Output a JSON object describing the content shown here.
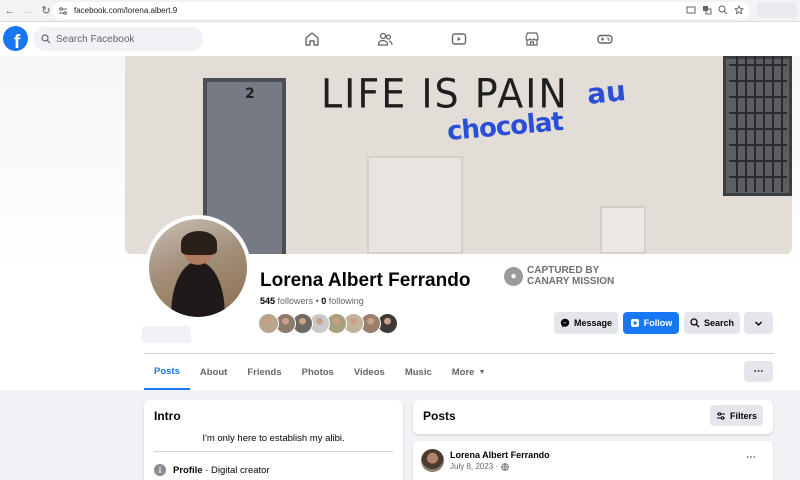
{
  "browser": {
    "url": "facebook.com/lorena.albert.9"
  },
  "topbar": {
    "search_placeholder": "Search Facebook",
    "nav_icons": [
      "home-icon",
      "friends-icon",
      "watch-icon",
      "marketplace-icon",
      "gaming-icon"
    ]
  },
  "cover": {
    "graffiti_text": "LIFE IS PAIN",
    "graffiti_blue_1": "au",
    "graffiti_blue_2": "chocolat",
    "door_number": "2"
  },
  "profile": {
    "name": "Lorena Albert Ferrando",
    "followers": "545",
    "followers_label": "followers",
    "separator": " • ",
    "following": "0",
    "following_label": "following",
    "badge_line1": "CAPTURED BY",
    "badge_line2": "CANARY MISSION"
  },
  "followers_preview_colors": [
    "#b9a58c",
    "#8d7b6e",
    "#6d6a66",
    "#c9c9c9",
    "#a89f7e",
    "#c1b29a",
    "#9a7f6c",
    "#3f3a36"
  ],
  "actions": {
    "message_label": "Message",
    "follow_label": "Follow",
    "search_label": "Search"
  },
  "tabs": [
    "Posts",
    "About",
    "Friends",
    "Photos",
    "Videos",
    "Music",
    "More"
  ],
  "intro": {
    "title": "Intro",
    "bio": "I'm only here to establish my alibi.",
    "profile_label": "Profile",
    "profile_type": " · Digital creator"
  },
  "posts": {
    "title": "Posts",
    "filters_label": "Filters",
    "first_post": {
      "author": "Lorena Albert Ferrando",
      "date": "July 8, 2023 ·"
    }
  },
  "colors": {
    "brand_blue": "#1877f2",
    "graffiti_blue": "#2a4fd6"
  }
}
